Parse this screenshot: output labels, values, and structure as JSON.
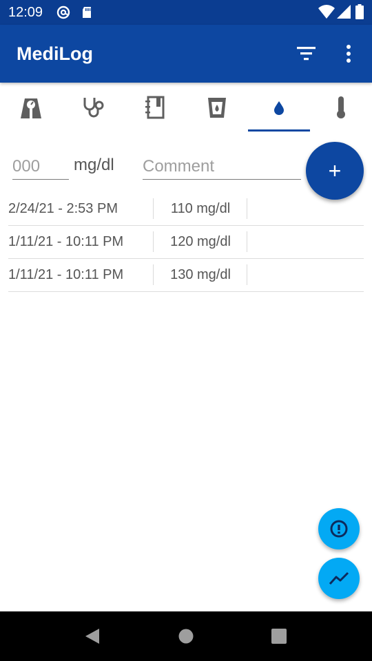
{
  "status_bar": {
    "time": "12:09",
    "icons": [
      "at-sign-icon",
      "sd-card-icon",
      "wifi-icon",
      "cell-signal-icon",
      "battery-icon"
    ]
  },
  "app_bar": {
    "title": "MediLog",
    "actions": [
      "filter-icon",
      "more-vert-icon"
    ]
  },
  "tabs": [
    {
      "icon": "weight-scale-icon",
      "selected": false
    },
    {
      "icon": "stethoscope-icon",
      "selected": false
    },
    {
      "icon": "diary-icon",
      "selected": false
    },
    {
      "icon": "water-glass-icon",
      "selected": false
    },
    {
      "icon": "blood-drop-icon",
      "selected": true
    },
    {
      "icon": "thermometer-icon",
      "selected": false
    }
  ],
  "entry": {
    "value_placeholder": "000",
    "unit": "mg/dl",
    "comment_placeholder": "Comment"
  },
  "entries": [
    {
      "date": "2/24/21 - 2:53 PM",
      "value": "110 mg/dl"
    },
    {
      "date": "1/11/21 - 10:11 PM",
      "value": "120 mg/dl"
    },
    {
      "date": "1/11/21 - 10:11 PM",
      "value": "130 mg/dl"
    }
  ],
  "fab": {
    "add_label": "+"
  },
  "colors": {
    "primary": "#0d47a1",
    "status_bar": "#0b3d91",
    "accent": "#03a9f4",
    "tab_icon": "#5f5f5f"
  },
  "nav_bar": {
    "buttons": [
      "back-icon",
      "home-icon",
      "recents-icon"
    ]
  }
}
